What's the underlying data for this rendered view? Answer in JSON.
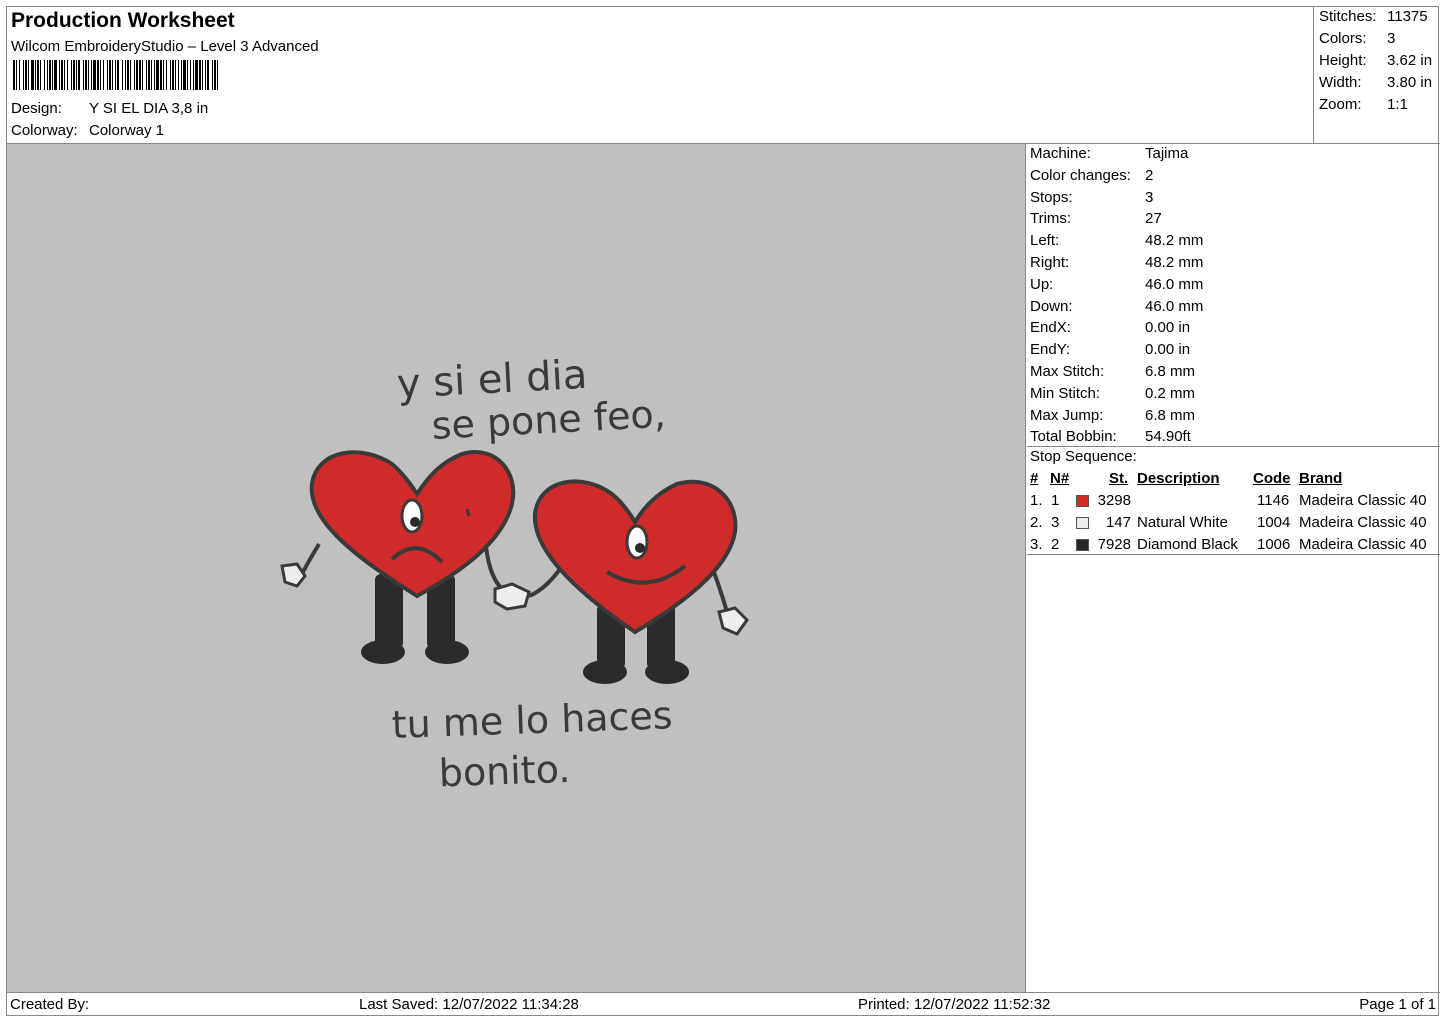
{
  "header": {
    "title": "Production Worksheet",
    "software": "Wilcom EmbroideryStudio – Level 3 Advanced",
    "design_label": "Design:",
    "design_value": "Y SI EL DIA 3,8 in",
    "colorway_label": "Colorway:",
    "colorway_value": "Colorway 1"
  },
  "stats": [
    {
      "label": "Stitches:",
      "value": "11375"
    },
    {
      "label": "Colors:",
      "value": "3"
    },
    {
      "label": "Height:",
      "value": "3.62 in"
    },
    {
      "label": "Width:",
      "value": "3.80 in"
    },
    {
      "label": "Zoom:",
      "value": "1:1"
    }
  ],
  "machine_info": [
    {
      "label": "Machine:",
      "value": "Tajima"
    },
    {
      "label": "Color changes:",
      "value": "2"
    },
    {
      "label": "Stops:",
      "value": "3"
    },
    {
      "label": "Trims:",
      "value": "27"
    },
    {
      "label": "Left:",
      "value": "48.2 mm"
    },
    {
      "label": "Right:",
      "value": "48.2 mm"
    },
    {
      "label": "Up:",
      "value": "46.0 mm"
    },
    {
      "label": "Down:",
      "value": "46.0 mm"
    },
    {
      "label": "EndX:",
      "value": "0.00 in"
    },
    {
      "label": "EndY:",
      "value": "0.00 in"
    },
    {
      "label": "Max Stitch:",
      "value": "6.8 mm"
    },
    {
      "label": "Min Stitch:",
      "value": "0.2 mm"
    },
    {
      "label": "Max Jump:",
      "value": "6.8 mm"
    },
    {
      "label": "Total Bobbin:",
      "value": "54.90ft"
    }
  ],
  "stop_sequence": {
    "title": "Stop Sequence:",
    "headers": [
      "#",
      "N#",
      "St.",
      "Description",
      "Code",
      "Brand"
    ],
    "rows": [
      {
        "num": "1.",
        "n": "1",
        "color": "#d42a24",
        "st": "3298",
        "description": "",
        "code": "1146",
        "brand": "Madeira Classic 40"
      },
      {
        "num": "2.",
        "n": "3",
        "color": "#eeeeee",
        "st": "147",
        "description": "Natural White",
        "code": "1004",
        "brand": "Madeira Classic 40"
      },
      {
        "num": "3.",
        "n": "2",
        "color": "#262626",
        "st": "7928",
        "description": "Diamond Black",
        "code": "1006",
        "brand": "Madeira Classic 40"
      }
    ]
  },
  "design_text": {
    "line1": "y si el dia",
    "line2": "se pone feo,",
    "line3": "tu me lo haces",
    "line4": "bonito."
  },
  "footer": {
    "created_by": "Created By:",
    "last_saved": "Last Saved: 12/07/2022 11:34:28",
    "printed": "Printed: 12/07/2022 11:52:32",
    "page": "Page 1 of 1"
  }
}
